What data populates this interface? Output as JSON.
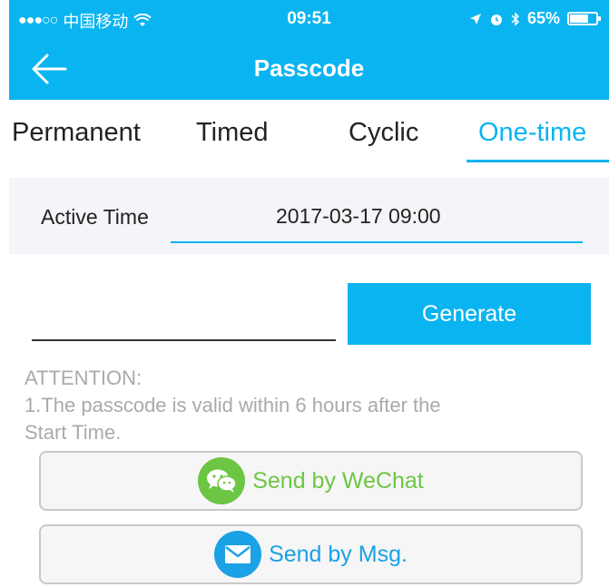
{
  "status_bar": {
    "carrier": "中国移动",
    "time": "09:51",
    "battery": "65%"
  },
  "nav": {
    "title": "Passcode"
  },
  "tabs": [
    {
      "label": "Permanent"
    },
    {
      "label": "Timed"
    },
    {
      "label": "Cyclic"
    },
    {
      "label": "One-time"
    }
  ],
  "active_tab": "One-time",
  "active_time": {
    "label": "Active Time",
    "value": "2017-03-17 09:00"
  },
  "passcode_field": {
    "value": ""
  },
  "generate_label": "Generate",
  "attention": {
    "title": "ATTENTION:",
    "line1": "1.The passcode is valid within 6 hours after the",
    "line2": "Start Time."
  },
  "send": {
    "wechat_label": "Send by WeChat",
    "msg_label": "Send by Msg."
  },
  "colors": {
    "accent": "#0ab4f0",
    "wechat_green": "#6cc644",
    "msg_blue": "#1aa1e6"
  }
}
